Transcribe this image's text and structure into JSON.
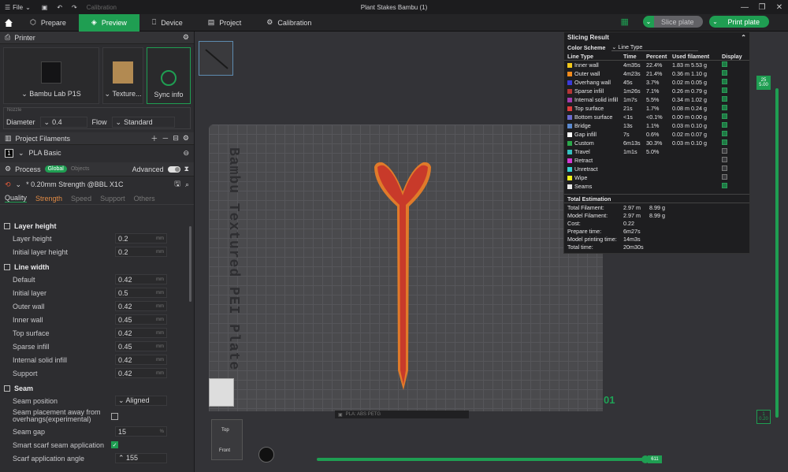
{
  "window": {
    "title": "Plant Stakes Bambu (1)",
    "file_menu": "File",
    "calibration_small": "Calibration"
  },
  "nav": {
    "prepare": "Prepare",
    "preview": "Preview",
    "device": "Device",
    "project": "Project",
    "calibration": "Calibration",
    "slice": "Slice plate",
    "print": "Print plate"
  },
  "printer": {
    "header": "Printer",
    "name": "Bambu Lab P1S",
    "plate": "Texture...",
    "sync": "Sync info",
    "nozzle_caption": "Nozzle",
    "diameter_label": "Diameter",
    "diameter_value": "0.4",
    "flow_label": "Flow",
    "flow_value": "Standard"
  },
  "filaments": {
    "header": "Project Filaments",
    "index": "1",
    "name": "PLA Basic"
  },
  "process": {
    "header": "Process",
    "global": "Global",
    "objects": "Objects",
    "advanced": "Advanced",
    "preset": "* 0.20mm Strength @BBL X1C",
    "tabs": [
      "Quality",
      "Strength",
      "Speed",
      "Support",
      "Others"
    ]
  },
  "params": {
    "layer_height": {
      "title": "Layer height",
      "rows": [
        {
          "label": "Layer height",
          "value": "0.2",
          "unit": "mm"
        },
        {
          "label": "Initial layer height",
          "value": "0.2",
          "unit": "mm"
        }
      ]
    },
    "line_width": {
      "title": "Line width",
      "rows": [
        {
          "label": "Default",
          "value": "0.42",
          "unit": "mm"
        },
        {
          "label": "Initial layer",
          "value": "0.5",
          "unit": "mm"
        },
        {
          "label": "Outer wall",
          "value": "0.42",
          "unit": "mm"
        },
        {
          "label": "Inner wall",
          "value": "0.45",
          "unit": "mm"
        },
        {
          "label": "Top surface",
          "value": "0.42",
          "unit": "mm"
        },
        {
          "label": "Sparse infill",
          "value": "0.45",
          "unit": "mm"
        },
        {
          "label": "Internal solid infill",
          "value": "0.42",
          "unit": "mm"
        },
        {
          "label": "Support",
          "value": "0.42",
          "unit": "mm"
        }
      ]
    },
    "seam": {
      "title": "Seam",
      "position_label": "Seam position",
      "position_value": "Aligned",
      "away_label": "Seam placement away from overhangs(experimental)",
      "gap_label": "Seam gap",
      "gap_value": "15",
      "gap_unit": "%",
      "scarf_label": "Smart scarf seam application",
      "angle_label": "Scarf application angle",
      "angle_value": "155"
    }
  },
  "bed": {
    "label": "Bambu Textured PEI Plate",
    "layer_number": "01",
    "footer": "PLA: ABS PETG"
  },
  "result": {
    "title": "Slicing Result",
    "scheme_label": "Color Scheme",
    "scheme_value": "Line Type",
    "cols": [
      "Line Type",
      "Time",
      "Percent",
      "Used filament",
      "Display"
    ],
    "rows": [
      {
        "name": "Inner wall",
        "color": "#f2c81b",
        "time": "4m35s",
        "pct": "22.4%",
        "len": "1.83 m",
        "wt": "5.53 g",
        "on": true
      },
      {
        "name": "Outer wall",
        "color": "#f28b1b",
        "time": "4m23s",
        "pct": "21.4%",
        "len": "0.36 m",
        "wt": "1.10 g",
        "on": true
      },
      {
        "name": "Overhang wall",
        "color": "#3a3ad9",
        "time": "45s",
        "pct": "3.7%",
        "len": "0.02 m",
        "wt": "0.05 g",
        "on": true
      },
      {
        "name": "Sparse infill",
        "color": "#b53535",
        "time": "1m26s",
        "pct": "7.1%",
        "len": "0.26 m",
        "wt": "0.79 g",
        "on": true
      },
      {
        "name": "Internal solid infill",
        "color": "#a13dac",
        "time": "1m7s",
        "pct": "5.5%",
        "len": "0.34 m",
        "wt": "1.02 g",
        "on": true
      },
      {
        "name": "Top surface",
        "color": "#e03d3d",
        "time": "21s",
        "pct": "1.7%",
        "len": "0.08 m",
        "wt": "0.24 g",
        "on": true
      },
      {
        "name": "Bottom surface",
        "color": "#6a6ad0",
        "time": "<1s",
        "pct": "<0.1%",
        "len": "0.00 m",
        "wt": "0.00 g",
        "on": true
      },
      {
        "name": "Bridge",
        "color": "#5a8ad0",
        "time": "13s",
        "pct": "1.1%",
        "len": "0.03 m",
        "wt": "0.10 g",
        "on": true
      },
      {
        "name": "Gap infill",
        "color": "#ffffff",
        "time": "7s",
        "pct": "0.6%",
        "len": "0.02 m",
        "wt": "0.07 g",
        "on": true
      },
      {
        "name": "Custom",
        "color": "#2aa84a",
        "time": "6m13s",
        "pct": "30.3%",
        "len": "0.03 m",
        "wt": "0.10 g",
        "on": true
      },
      {
        "name": "Travel",
        "color": "#35c0c0",
        "time": "1m1s",
        "pct": "5.0%",
        "len": "",
        "wt": "",
        "on": false
      },
      {
        "name": "Retract",
        "color": "#d23ad2",
        "time": "",
        "pct": "",
        "len": "",
        "wt": "",
        "on": false
      },
      {
        "name": "Unretract",
        "color": "#3ad2d2",
        "time": "",
        "pct": "",
        "len": "",
        "wt": "",
        "on": false
      },
      {
        "name": "Wipe",
        "color": "#f2f21b",
        "time": "",
        "pct": "",
        "len": "",
        "wt": "",
        "on": false
      },
      {
        "name": "Seams",
        "color": "#e8e8e8",
        "time": "",
        "pct": "",
        "len": "",
        "wt": "",
        "on": true
      }
    ],
    "est_title": "Total Estimation",
    "est": [
      {
        "label": "Total Filament:",
        "v1": "2.97 m",
        "v2": "8.99 g"
      },
      {
        "label": "Model Filament:",
        "v1": "2.97 m",
        "v2": "8.99 g"
      },
      {
        "label": "Cost:",
        "v1": "0.22",
        "v2": ""
      },
      {
        "label": "Prepare time:",
        "v1": "6m27s",
        "v2": ""
      },
      {
        "label": "Model printing time:",
        "v1": "14m3s",
        "v2": ""
      },
      {
        "label": "Total time:",
        "v1": "20m30s",
        "v2": ""
      }
    ]
  },
  "layers": {
    "top_num": "25",
    "top_h": "5.00",
    "bot_num": "1",
    "bot_h": "0.20",
    "move": "611"
  },
  "navcube": {
    "top": "Top",
    "front": "Front"
  },
  "colors": {
    "accent": "#1f9e52",
    "stake_outer": "#e07b2a",
    "stake_inner": "#c83a2a"
  }
}
